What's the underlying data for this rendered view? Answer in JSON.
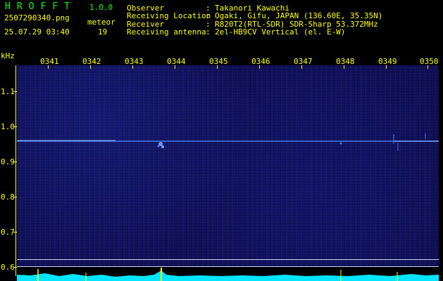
{
  "app": {
    "title_letters": "HROFFT",
    "version": "1.0.0",
    "filename": "2507290340.png",
    "datetime": "25.07.29 03:40",
    "meteor_label": "meteor",
    "meteor_count": "19"
  },
  "info": [
    {
      "key": "Observer",
      "sep": ":",
      "value": "Takanori Kawachi"
    },
    {
      "key": "Receiving Location",
      "sep": ":",
      "value": "Ogaki, Gifu, JAPAN (136.60E, 35.35N)"
    },
    {
      "key": "Receiver",
      "sep": ":",
      "value": "R820T2(RTL-SDR) SDR-Sharp 53.372MHz"
    },
    {
      "key": "Receiving antenna",
      "sep": ":",
      "value": "2el-HB9CV Vertical (el. E-W)"
    }
  ],
  "spectrogram": {
    "y_unit": "kHz",
    "x_ticks": [
      "0341",
      "0342",
      "0343",
      "0344",
      "0345",
      "0346",
      "0347",
      "0348",
      "0349",
      "0350"
    ],
    "y_ticks": [
      "1.1",
      "1.0",
      "0.9",
      "0.8",
      "0.7",
      "0.6"
    ],
    "colors": {
      "axis": "#ffff00",
      "signal": "#6aa8ff",
      "background": "#0f0f50",
      "level_bars": "#00e5ff"
    }
  }
}
